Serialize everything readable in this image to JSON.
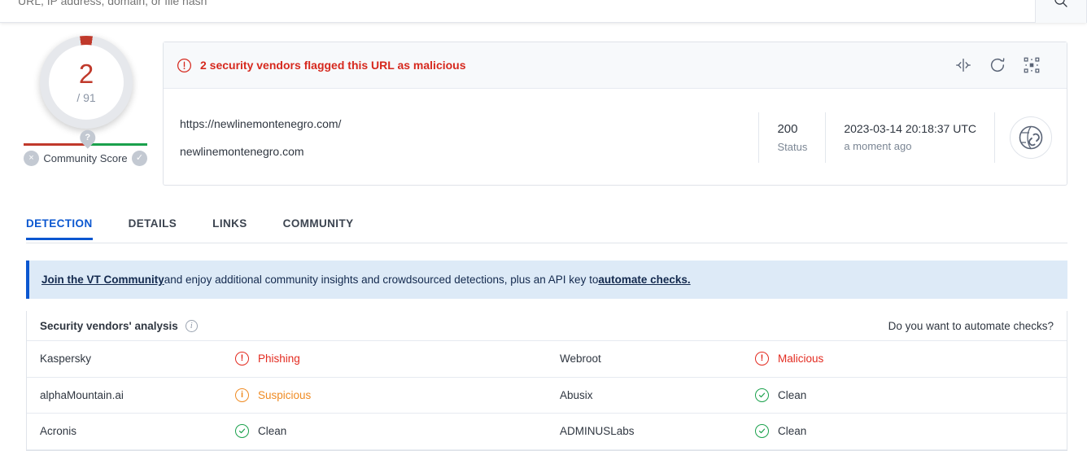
{
  "topbar": {
    "search_placeholder": "URL, IP address, domain, or file hash",
    "search_value": "",
    "search_icon": "search-icon"
  },
  "score": {
    "detections": "2",
    "total": "/ 91",
    "community_label": "Community Score",
    "pin_glyph": "?",
    "negative_glyph": "×",
    "positive_glyph": "✓",
    "colors": {
      "malicious": "#c0392b",
      "clean": "#1aa14c",
      "neutral": "#c3c9d2"
    }
  },
  "report": {
    "alert_text": "2 security vendors flagged this URL as malicious",
    "alert_icon": "exclamation-circle-icon",
    "actions": [
      {
        "name": "compare-icon",
        "label": "Compare"
      },
      {
        "name": "reanalyze-icon",
        "label": "Reanalyze"
      },
      {
        "name": "graph-icon",
        "label": "Graph"
      }
    ],
    "url": "https://newlinemontenegro.com/",
    "domain": "newlinemontenegro.com",
    "status_code": "200",
    "status_label": "Status",
    "scan_date": "2023-03-14 20:18:37 UTC",
    "scan_relative": "a moment ago",
    "badge_icon": "globe-link-icon"
  },
  "tabs": [
    {
      "label": "DETECTION",
      "active": true
    },
    {
      "label": "DETAILS",
      "active": false
    },
    {
      "label": "LINKS",
      "active": false
    },
    {
      "label": "COMMUNITY",
      "active": false
    }
  ],
  "banner": {
    "link_start": "Join the VT Community",
    "middle": " and enjoy additional community insights and crowdsourced detections, plus an API key to ",
    "link_end": "automate checks."
  },
  "vendors": {
    "title": "Security vendors' analysis",
    "info_icon": "info-icon",
    "cta": "Do you want to automate checks?",
    "rows": [
      {
        "left": {
          "name": "Kaspersky",
          "result": "Phishing",
          "severity": "malicious"
        },
        "right": {
          "name": "Webroot",
          "result": "Malicious",
          "severity": "malicious"
        }
      },
      {
        "left": {
          "name": "alphaMountain.ai",
          "result": "Suspicious",
          "severity": "suspicious"
        },
        "right": {
          "name": "Abusix",
          "result": "Clean",
          "severity": "clean"
        }
      },
      {
        "left": {
          "name": "Acronis",
          "result": "Clean",
          "severity": "clean"
        },
        "right": {
          "name": "ADMINUSLabs",
          "result": "Clean",
          "severity": "clean"
        }
      }
    ]
  }
}
